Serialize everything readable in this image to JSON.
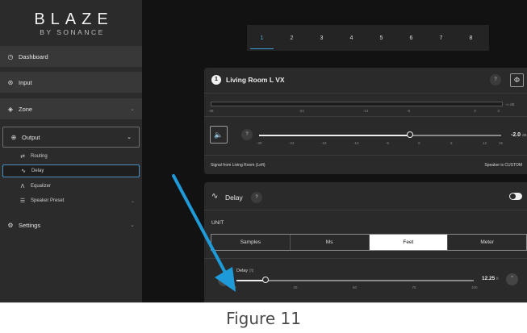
{
  "brand": {
    "name": "BLAZE",
    "sub": "BY SONANCE"
  },
  "sidebar": {
    "items": [
      {
        "label": "Dashboard",
        "icon": "dashboard-icon"
      },
      {
        "label": "Input",
        "icon": "input-icon"
      },
      {
        "label": "Zone",
        "icon": "zone-icon"
      },
      {
        "label": "Output",
        "icon": "output-icon"
      },
      {
        "label": "Settings",
        "icon": "settings-icon"
      }
    ],
    "output_sub": [
      {
        "label": "Routing",
        "icon": "routing-icon"
      },
      {
        "label": "Delay",
        "icon": "delay-icon"
      },
      {
        "label": "Equalizer",
        "icon": "equalizer-icon"
      },
      {
        "label": "Speaker Preset",
        "icon": "speaker-preset-icon"
      }
    ]
  },
  "channel_tabs": [
    "1",
    "2",
    "3",
    "4",
    "5",
    "6",
    "7",
    "8"
  ],
  "selected_tab": "1",
  "channel": {
    "number": "1",
    "name": "Living Room L VX",
    "help": "?",
    "meter_ticks": [
      "-48",
      "-24",
      "-12",
      "-6",
      "0",
      "3"
    ],
    "meter_unit": "-∞ dB",
    "gain": {
      "ticks": [
        "-30",
        "-24",
        "-18",
        "-12",
        "-6",
        "0",
        "6",
        "12",
        "15"
      ],
      "value": -2.0,
      "value_text": "-2.0",
      "unit": "dB",
      "min": -30,
      "max": 15
    },
    "source_text": "Signal from Living Room (Left)",
    "speaker_text": "Speaker is CUSTOM"
  },
  "delay": {
    "title": "Delay",
    "help": "?",
    "enabled": true,
    "unit_label": "UNIT",
    "units": [
      "Samples",
      "Ms",
      "Feet",
      "Meter"
    ],
    "selected_unit": "Feet",
    "slider_label": "Delay",
    "slider_unit": "[ft]",
    "value": 12.25,
    "value_text": "12.25",
    "value_unit": "ft",
    "ticks": [
      "0",
      "25",
      "50",
      "75",
      "100"
    ],
    "min": 0,
    "max": 100
  },
  "caption": "Figure 11",
  "colors": {
    "accent": "#3a9ad6",
    "arrow": "#1f9ad8"
  }
}
